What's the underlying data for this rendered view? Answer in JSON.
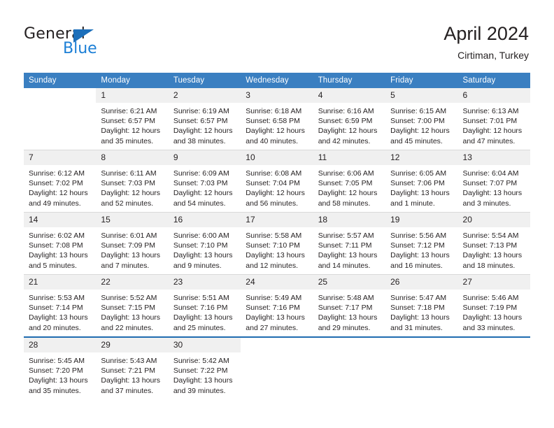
{
  "brand": {
    "name_part1": "General",
    "name_part2": "Blue",
    "triangle_icon": "triangle-icon",
    "accent_color": "#1c7fd6",
    "logo_dark_color": "#231f20"
  },
  "header": {
    "title": "April 2024",
    "subtitle": "Cirtiman, Turkey"
  },
  "theme": {
    "header_row_background": "#3a7fc1",
    "header_row_text": "#ffffff",
    "day_number_band": "#f0f0f0",
    "cell_divider": "#d9d9d9",
    "last_week_divider": "#1f6cb0"
  },
  "weekdays": [
    "Sunday",
    "Monday",
    "Tuesday",
    "Wednesday",
    "Thursday",
    "Friday",
    "Saturday"
  ],
  "weeks": [
    [
      {
        "day": "",
        "sunrise": "",
        "sunset": "",
        "daylight_line1": "",
        "daylight_line2": ""
      },
      {
        "day": "1",
        "sunrise": "Sunrise: 6:21 AM",
        "sunset": "Sunset: 6:57 PM",
        "daylight_line1": "Daylight: 12 hours",
        "daylight_line2": "and 35 minutes."
      },
      {
        "day": "2",
        "sunrise": "Sunrise: 6:19 AM",
        "sunset": "Sunset: 6:57 PM",
        "daylight_line1": "Daylight: 12 hours",
        "daylight_line2": "and 38 minutes."
      },
      {
        "day": "3",
        "sunrise": "Sunrise: 6:18 AM",
        "sunset": "Sunset: 6:58 PM",
        "daylight_line1": "Daylight: 12 hours",
        "daylight_line2": "and 40 minutes."
      },
      {
        "day": "4",
        "sunrise": "Sunrise: 6:16 AM",
        "sunset": "Sunset: 6:59 PM",
        "daylight_line1": "Daylight: 12 hours",
        "daylight_line2": "and 42 minutes."
      },
      {
        "day": "5",
        "sunrise": "Sunrise: 6:15 AM",
        "sunset": "Sunset: 7:00 PM",
        "daylight_line1": "Daylight: 12 hours",
        "daylight_line2": "and 45 minutes."
      },
      {
        "day": "6",
        "sunrise": "Sunrise: 6:13 AM",
        "sunset": "Sunset: 7:01 PM",
        "daylight_line1": "Daylight: 12 hours",
        "daylight_line2": "and 47 minutes."
      }
    ],
    [
      {
        "day": "7",
        "sunrise": "Sunrise: 6:12 AM",
        "sunset": "Sunset: 7:02 PM",
        "daylight_line1": "Daylight: 12 hours",
        "daylight_line2": "and 49 minutes."
      },
      {
        "day": "8",
        "sunrise": "Sunrise: 6:11 AM",
        "sunset": "Sunset: 7:03 PM",
        "daylight_line1": "Daylight: 12 hours",
        "daylight_line2": "and 52 minutes."
      },
      {
        "day": "9",
        "sunrise": "Sunrise: 6:09 AM",
        "sunset": "Sunset: 7:03 PM",
        "daylight_line1": "Daylight: 12 hours",
        "daylight_line2": "and 54 minutes."
      },
      {
        "day": "10",
        "sunrise": "Sunrise: 6:08 AM",
        "sunset": "Sunset: 7:04 PM",
        "daylight_line1": "Daylight: 12 hours",
        "daylight_line2": "and 56 minutes."
      },
      {
        "day": "11",
        "sunrise": "Sunrise: 6:06 AM",
        "sunset": "Sunset: 7:05 PM",
        "daylight_line1": "Daylight: 12 hours",
        "daylight_line2": "and 58 minutes."
      },
      {
        "day": "12",
        "sunrise": "Sunrise: 6:05 AM",
        "sunset": "Sunset: 7:06 PM",
        "daylight_line1": "Daylight: 13 hours",
        "daylight_line2": "and 1 minute."
      },
      {
        "day": "13",
        "sunrise": "Sunrise: 6:04 AM",
        "sunset": "Sunset: 7:07 PM",
        "daylight_line1": "Daylight: 13 hours",
        "daylight_line2": "and 3 minutes."
      }
    ],
    [
      {
        "day": "14",
        "sunrise": "Sunrise: 6:02 AM",
        "sunset": "Sunset: 7:08 PM",
        "daylight_line1": "Daylight: 13 hours",
        "daylight_line2": "and 5 minutes."
      },
      {
        "day": "15",
        "sunrise": "Sunrise: 6:01 AM",
        "sunset": "Sunset: 7:09 PM",
        "daylight_line1": "Daylight: 13 hours",
        "daylight_line2": "and 7 minutes."
      },
      {
        "day": "16",
        "sunrise": "Sunrise: 6:00 AM",
        "sunset": "Sunset: 7:10 PM",
        "daylight_line1": "Daylight: 13 hours",
        "daylight_line2": "and 9 minutes."
      },
      {
        "day": "17",
        "sunrise": "Sunrise: 5:58 AM",
        "sunset": "Sunset: 7:10 PM",
        "daylight_line1": "Daylight: 13 hours",
        "daylight_line2": "and 12 minutes."
      },
      {
        "day": "18",
        "sunrise": "Sunrise: 5:57 AM",
        "sunset": "Sunset: 7:11 PM",
        "daylight_line1": "Daylight: 13 hours",
        "daylight_line2": "and 14 minutes."
      },
      {
        "day": "19",
        "sunrise": "Sunrise: 5:56 AM",
        "sunset": "Sunset: 7:12 PM",
        "daylight_line1": "Daylight: 13 hours",
        "daylight_line2": "and 16 minutes."
      },
      {
        "day": "20",
        "sunrise": "Sunrise: 5:54 AM",
        "sunset": "Sunset: 7:13 PM",
        "daylight_line1": "Daylight: 13 hours",
        "daylight_line2": "and 18 minutes."
      }
    ],
    [
      {
        "day": "21",
        "sunrise": "Sunrise: 5:53 AM",
        "sunset": "Sunset: 7:14 PM",
        "daylight_line1": "Daylight: 13 hours",
        "daylight_line2": "and 20 minutes."
      },
      {
        "day": "22",
        "sunrise": "Sunrise: 5:52 AM",
        "sunset": "Sunset: 7:15 PM",
        "daylight_line1": "Daylight: 13 hours",
        "daylight_line2": "and 22 minutes."
      },
      {
        "day": "23",
        "sunrise": "Sunrise: 5:51 AM",
        "sunset": "Sunset: 7:16 PM",
        "daylight_line1": "Daylight: 13 hours",
        "daylight_line2": "and 25 minutes."
      },
      {
        "day": "24",
        "sunrise": "Sunrise: 5:49 AM",
        "sunset": "Sunset: 7:16 PM",
        "daylight_line1": "Daylight: 13 hours",
        "daylight_line2": "and 27 minutes."
      },
      {
        "day": "25",
        "sunrise": "Sunrise: 5:48 AM",
        "sunset": "Sunset: 7:17 PM",
        "daylight_line1": "Daylight: 13 hours",
        "daylight_line2": "and 29 minutes."
      },
      {
        "day": "26",
        "sunrise": "Sunrise: 5:47 AM",
        "sunset": "Sunset: 7:18 PM",
        "daylight_line1": "Daylight: 13 hours",
        "daylight_line2": "and 31 minutes."
      },
      {
        "day": "27",
        "sunrise": "Sunrise: 5:46 AM",
        "sunset": "Sunset: 7:19 PM",
        "daylight_line1": "Daylight: 13 hours",
        "daylight_line2": "and 33 minutes."
      }
    ],
    [
      {
        "day": "28",
        "sunrise": "Sunrise: 5:45 AM",
        "sunset": "Sunset: 7:20 PM",
        "daylight_line1": "Daylight: 13 hours",
        "daylight_line2": "and 35 minutes."
      },
      {
        "day": "29",
        "sunrise": "Sunrise: 5:43 AM",
        "sunset": "Sunset: 7:21 PM",
        "daylight_line1": "Daylight: 13 hours",
        "daylight_line2": "and 37 minutes."
      },
      {
        "day": "30",
        "sunrise": "Sunrise: 5:42 AM",
        "sunset": "Sunset: 7:22 PM",
        "daylight_line1": "Daylight: 13 hours",
        "daylight_line2": "and 39 minutes."
      },
      {
        "day": "",
        "sunrise": "",
        "sunset": "",
        "daylight_line1": "",
        "daylight_line2": ""
      },
      {
        "day": "",
        "sunrise": "",
        "sunset": "",
        "daylight_line1": "",
        "daylight_line2": ""
      },
      {
        "day": "",
        "sunrise": "",
        "sunset": "",
        "daylight_line1": "",
        "daylight_line2": ""
      },
      {
        "day": "",
        "sunrise": "",
        "sunset": "",
        "daylight_line1": "",
        "daylight_line2": ""
      }
    ]
  ]
}
